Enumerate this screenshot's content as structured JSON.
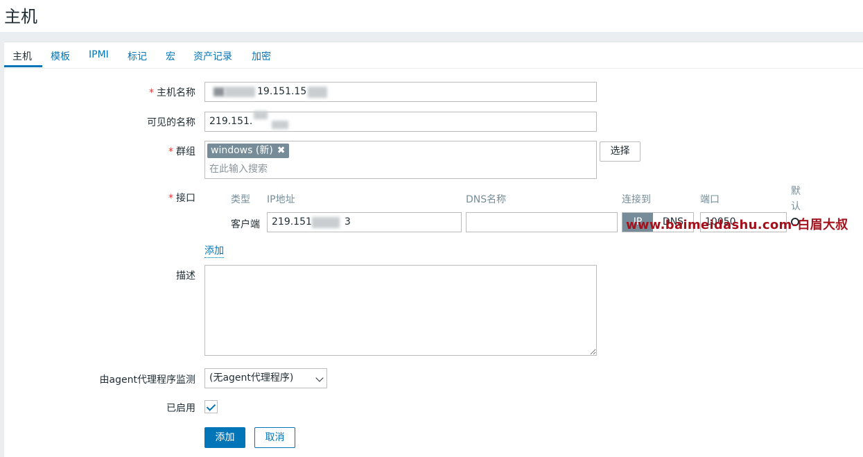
{
  "page": {
    "title": "主机"
  },
  "tabs": [
    {
      "label": "主机"
    },
    {
      "label": "模板"
    },
    {
      "label": "IPMI"
    },
    {
      "label": "标记"
    },
    {
      "label": "宏"
    },
    {
      "label": "资产记录"
    },
    {
      "label": "加密"
    }
  ],
  "form": {
    "required_mark": "*",
    "host_name": {
      "label": "主机名称",
      "value": "19.151.15"
    },
    "visible_name": {
      "label": "可见的名称",
      "value": "219.151."
    },
    "groups": {
      "label": "群组",
      "chip": "windows (新)",
      "chip_remove": "✖",
      "placeholder": "在此输入搜索",
      "select_button": "选择"
    },
    "interfaces": {
      "label": "接口",
      "columns": {
        "type": "类型",
        "ip": "IP地址",
        "dns": "DNS名称",
        "connect": "连接到",
        "port": "端口",
        "default": "默认"
      },
      "row": {
        "type": "客户端",
        "ip": "219.151",
        "ip_tail": "3",
        "dns": "",
        "connect_ip": "IP",
        "connect_dns": "DNS",
        "port": "10050"
      },
      "add_link": "添加"
    },
    "description": {
      "label": "描述",
      "value": ""
    },
    "monitored_by_proxy": {
      "label": "由agent代理程序监测",
      "selected": "(无agent代理程序)"
    },
    "enabled": {
      "label": "已启用",
      "checked": true
    },
    "buttons": {
      "add": "添加",
      "cancel": "取消"
    }
  },
  "watermark": "www.baimeidashu.com-白眉大叔",
  "colors": {
    "accent": "#0275b8",
    "required": "#e33734",
    "chip": "#768d99",
    "watermark": "#a3121c"
  }
}
